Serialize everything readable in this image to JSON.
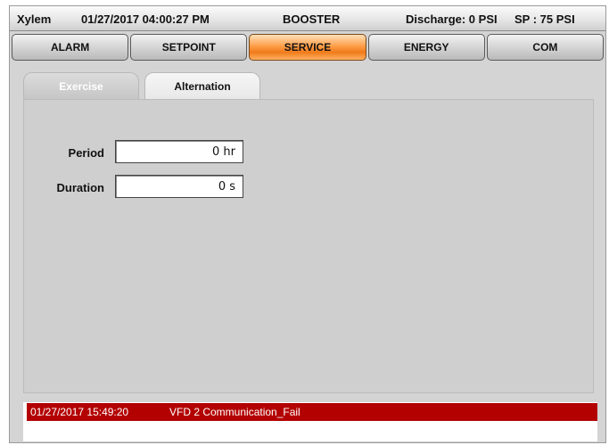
{
  "header": {
    "brand": "Xylem",
    "datetime": "01/27/2017 04:00:27 PM",
    "mode": "BOOSTER",
    "discharge": "Discharge: 0 PSI",
    "setpoint": "SP : 75 PSI"
  },
  "nav": {
    "items": [
      "ALARM",
      "SETPOINT",
      "SERVICE",
      "ENERGY",
      "COM"
    ],
    "active": "SERVICE"
  },
  "tabs": {
    "items": [
      "Exercise",
      "Alternation"
    ],
    "active": "Exercise"
  },
  "form": {
    "period": {
      "label": "Period",
      "value": "0 hr"
    },
    "duration": {
      "label": "Duration",
      "value": "0 s"
    }
  },
  "alarms": [
    {
      "timestamp": "01/27/2017 15:49:20",
      "message": "VFD 2 Communication_Fail"
    }
  ],
  "colors": {
    "active_nav": "#f07b1a",
    "alarm_bg": "#b30000",
    "panel_bg": "#cfcfcf"
  }
}
